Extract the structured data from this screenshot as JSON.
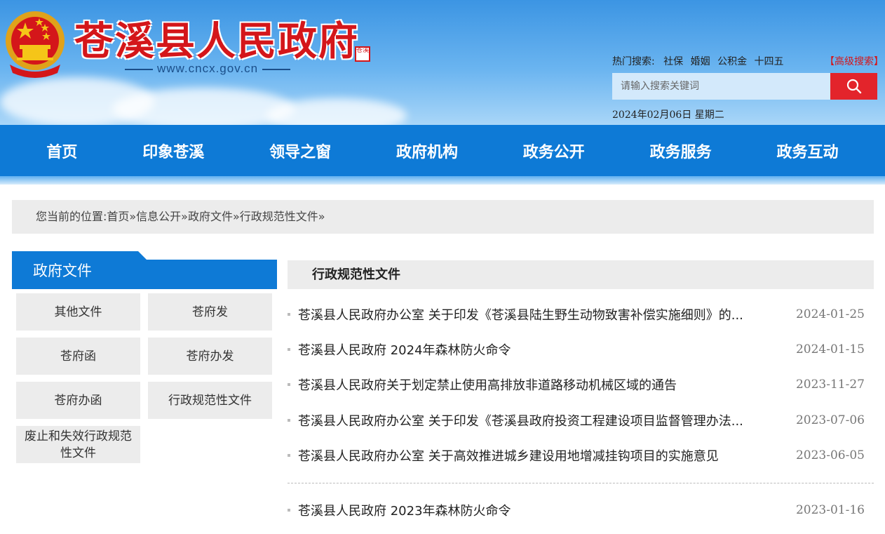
{
  "header": {
    "site_name": "苍溪县人民政府",
    "seal_text": "苍溪",
    "site_url": "www.cncx.gov.cn",
    "hot_search_label": "热门搜索:",
    "hot_search_terms": [
      "社保",
      "婚姻",
      "公积金",
      "十四五"
    ],
    "advanced_search": "【高级搜索】",
    "search_placeholder": "请输入搜索关键词",
    "date": "2024年02月06日 星期二"
  },
  "nav": [
    "首页",
    "印象苍溪",
    "领导之窗",
    "政府机构",
    "政务公开",
    "政务服务",
    "政务互动"
  ],
  "breadcrumb": "您当前的位置:首页»信息公开»政府文件»行政规范性文件»",
  "sidebar": {
    "title": "政府文件",
    "items": [
      "其他文件",
      "苍府发",
      "苍府函",
      "苍府办发",
      "苍府办函",
      "行政规范性文件",
      "废止和失效行政规范性文件"
    ]
  },
  "main": {
    "title": "行政规范性文件",
    "items": [
      {
        "title": "苍溪县人民政府办公室 关于印发《苍溪县陆生野生动物致害补偿实施细则》的...",
        "date": "2024-01-25"
      },
      {
        "title": "苍溪县人民政府 2024年森林防火命令",
        "date": "2024-01-15"
      },
      {
        "title": "苍溪县人民政府关于划定禁止使用高排放非道路移动机械区域的通告",
        "date": "2023-11-27"
      },
      {
        "title": "苍溪县人民政府办公室 关于印发《苍溪县政府投资工程建设项目监督管理办法...",
        "date": "2023-07-06"
      },
      {
        "title": "苍溪县人民政府办公室 关于高效推进城乡建设用地增减挂钩项目的实施意见",
        "date": "2023-06-05"
      },
      {
        "title": "苍溪县人民政府 2023年森林防火命令",
        "date": "2023-01-16"
      }
    ]
  },
  "colors": {
    "brand_red": "#d4161a",
    "nav_blue": "#0e7ad6",
    "search_red": "#e3242b"
  }
}
